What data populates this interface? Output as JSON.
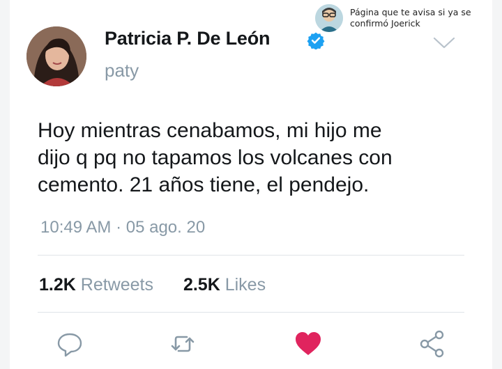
{
  "watermark": {
    "text": "Página que te avisa si ya se\nconfirmó Joerick"
  },
  "tweet": {
    "display_name": "Patricia P. De León",
    "handle": "paty",
    "text": "Hoy mientras cenabamos, mi  hijo me\ndijo q pq no  tapamos los volcanes con\ncemento. 21 años tiene, el pendejo.",
    "time": "10:49 AM",
    "separator": "·",
    "date": "05 ago. 20",
    "retweets_count": "1.2K",
    "retweets_label": "Retweets",
    "likes_count": "2.5K",
    "likes_label": "Likes"
  },
  "icons": {
    "verified": "verified-badge-icon",
    "menu": "chevron-down-icon",
    "reply": "reply-icon",
    "retweet": "retweet-icon",
    "like": "heart-icon",
    "share": "share-icon"
  },
  "colors": {
    "verified_blue": "#1da1f2",
    "muted_text": "#8899a6",
    "heart_red": "#e0245e",
    "primary_text": "#14171a"
  }
}
